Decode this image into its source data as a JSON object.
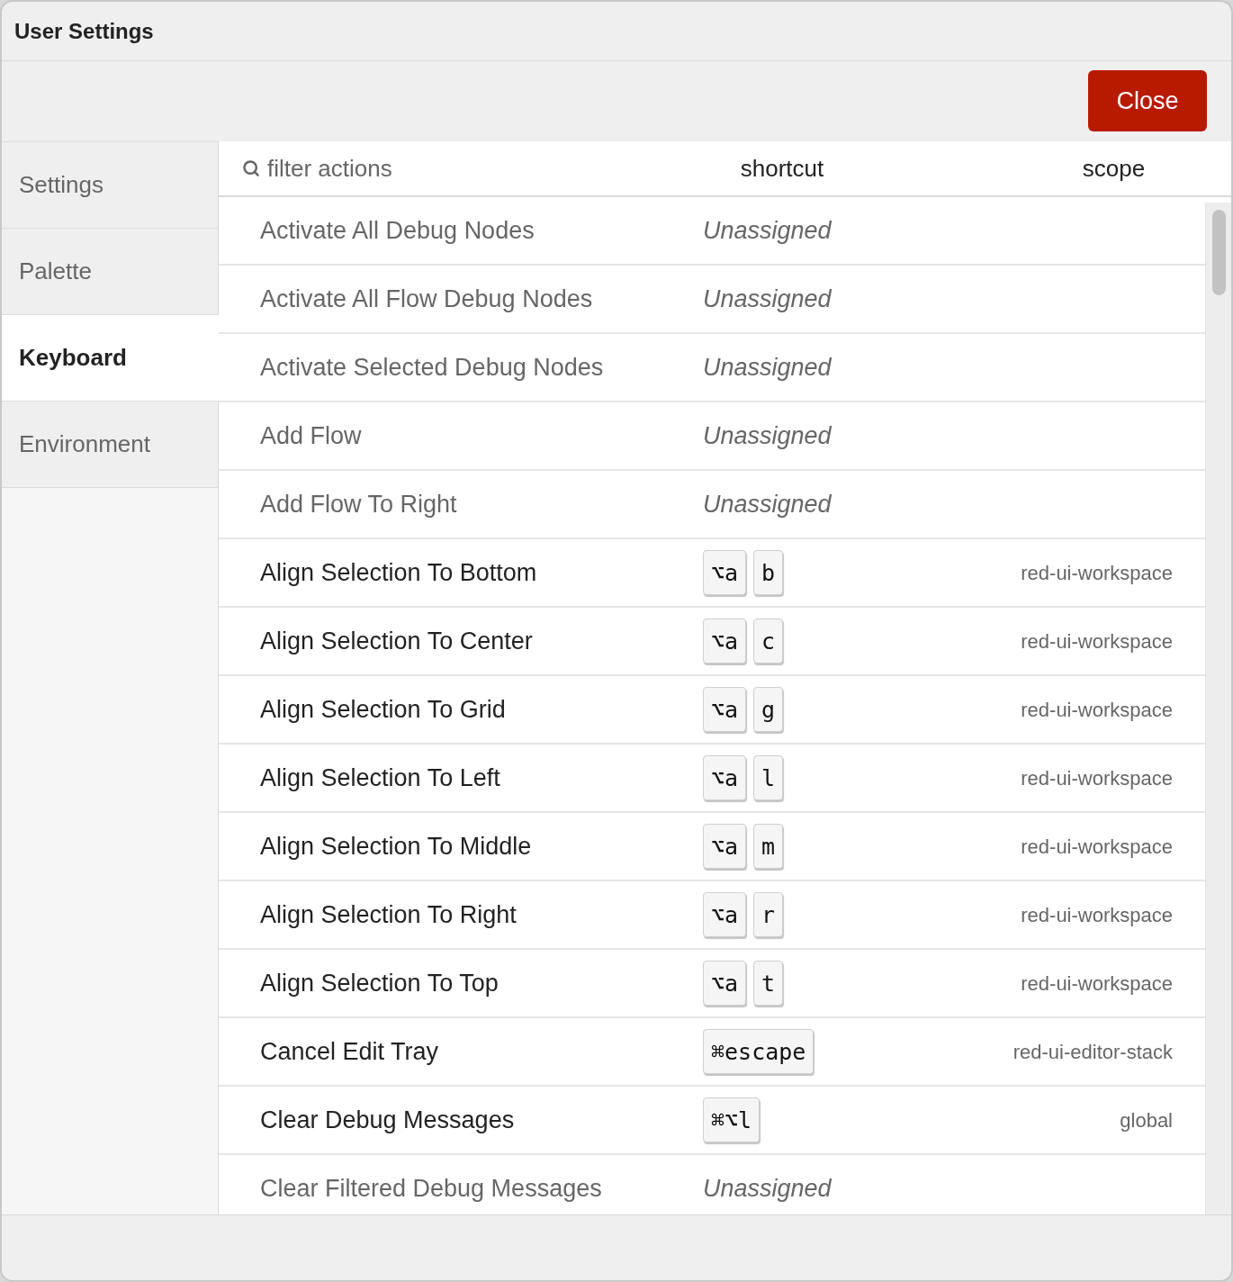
{
  "window": {
    "title": "User Settings"
  },
  "toolbar": {
    "close_button": "Close"
  },
  "tabs": [
    {
      "label": "Settings",
      "selected": false
    },
    {
      "label": "Palette",
      "selected": false
    },
    {
      "label": "Keyboard",
      "selected": true
    },
    {
      "label": "Environment",
      "selected": false
    }
  ],
  "filter": {
    "placeholder": "filter actions"
  },
  "columns": {
    "shortcut": "shortcut",
    "scope": "scope"
  },
  "actions": [
    {
      "name": "Activate All Debug Nodes",
      "shortcut": {
        "kind": "unassigned",
        "text": "Unassigned"
      }
    },
    {
      "name": "Activate All Flow Debug Nodes",
      "shortcut": {
        "kind": "unassigned",
        "text": "Unassigned"
      }
    },
    {
      "name": "Activate Selected Debug Nodes",
      "shortcut": {
        "kind": "unassigned",
        "text": "Unassigned"
      }
    },
    {
      "name": "Add Flow",
      "shortcut": {
        "kind": "unassigned",
        "text": "Unassigned"
      }
    },
    {
      "name": "Add Flow To Right",
      "shortcut": {
        "kind": "unassigned",
        "text": "Unassigned"
      }
    },
    {
      "name": "Align Selection To Bottom",
      "shortcut": {
        "kind": "keys",
        "keys": [
          "⌥a",
          "b"
        ]
      },
      "scope": "red-ui-workspace"
    },
    {
      "name": "Align Selection To Center",
      "shortcut": {
        "kind": "keys",
        "keys": [
          "⌥a",
          "c"
        ]
      },
      "scope": "red-ui-workspace"
    },
    {
      "name": "Align Selection To Grid",
      "shortcut": {
        "kind": "keys",
        "keys": [
          "⌥a",
          "g"
        ]
      },
      "scope": "red-ui-workspace"
    },
    {
      "name": "Align Selection To Left",
      "shortcut": {
        "kind": "keys",
        "keys": [
          "⌥a",
          "l"
        ]
      },
      "scope": "red-ui-workspace"
    },
    {
      "name": "Align Selection To Middle",
      "shortcut": {
        "kind": "keys",
        "keys": [
          "⌥a",
          "m"
        ]
      },
      "scope": "red-ui-workspace"
    },
    {
      "name": "Align Selection To Right",
      "shortcut": {
        "kind": "keys",
        "keys": [
          "⌥a",
          "r"
        ]
      },
      "scope": "red-ui-workspace"
    },
    {
      "name": "Align Selection To Top",
      "shortcut": {
        "kind": "keys",
        "keys": [
          "⌥a",
          "t"
        ]
      },
      "scope": "red-ui-workspace"
    },
    {
      "name": "Cancel Edit Tray",
      "shortcut": {
        "kind": "keys",
        "keys": [
          "⌘escape"
        ]
      },
      "scope": "red-ui-editor-stack"
    },
    {
      "name": "Clear Debug Messages",
      "shortcut": {
        "kind": "keys",
        "keys": [
          "⌘⌥l"
        ]
      },
      "scope": "global"
    },
    {
      "name": "Clear Filtered Debug Messages",
      "shortcut": {
        "kind": "unassigned",
        "text": "Unassigned"
      }
    }
  ]
}
